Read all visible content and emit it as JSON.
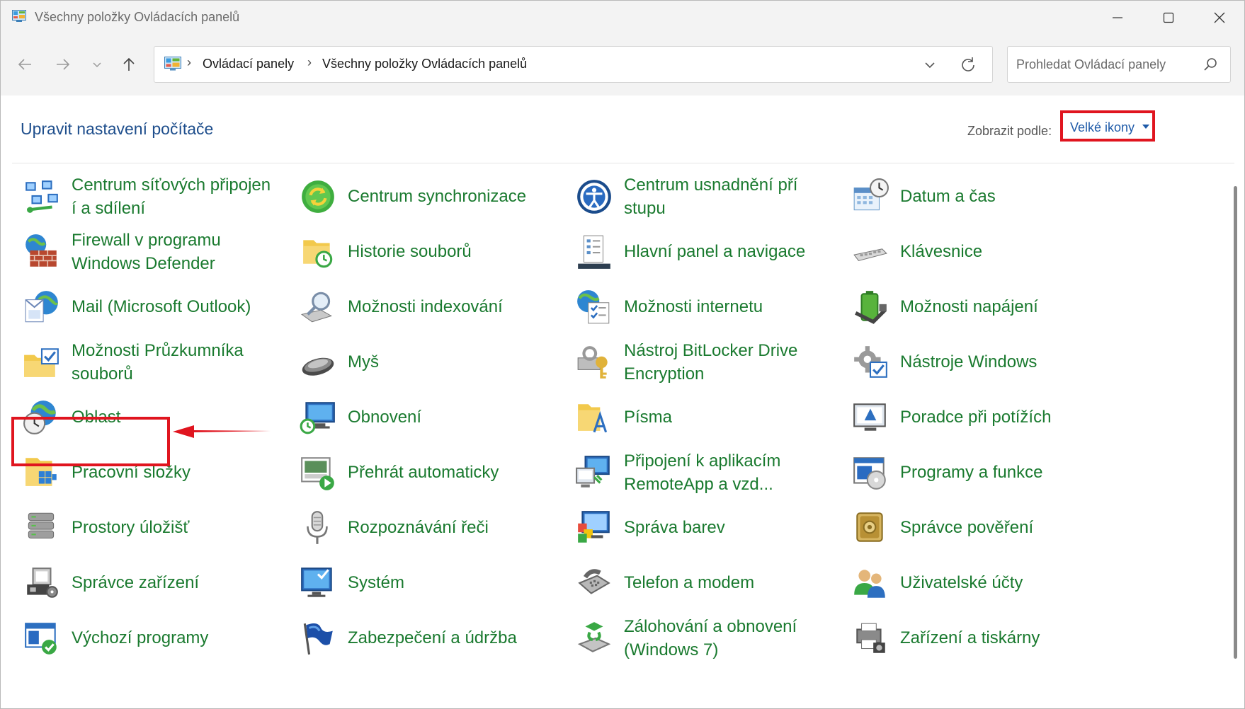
{
  "window": {
    "title": "Všechny položky Ovládacích panelů"
  },
  "nav": {
    "breadcrumb": [
      "Ovládací panely",
      "Všechny položky Ovládacích panelů"
    ],
    "search_placeholder": "Prohledat Ovládací panely"
  },
  "header": {
    "title": "Upravit nastavení počítače",
    "view_by_label": "Zobrazit podle:",
    "view_by_value": "Velké ikony"
  },
  "items": [
    {
      "label": "Centrum síťových připojení a sdílení",
      "line1": "Centrum síťových připojen",
      "line2": "í a sdílení",
      "icon": "network-center-icon"
    },
    {
      "label": "Centrum synchronizace",
      "line1": "Centrum synchronizace",
      "line2": "",
      "icon": "sync-center-icon"
    },
    {
      "label": "Centrum usnadnění přístupu",
      "line1": "Centrum usnadnění pří",
      "line2": "stupu",
      "icon": "ease-of-access-icon"
    },
    {
      "label": "Datum a čas",
      "line1": "Datum a čas",
      "line2": "",
      "icon": "date-time-icon"
    },
    {
      "label": "Firewall v programu Windows Defender",
      "line1": "Firewall v programu",
      "line2": "Windows Defender",
      "icon": "firewall-icon"
    },
    {
      "label": "Historie souborů",
      "line1": "Historie souborů",
      "line2": "",
      "icon": "file-history-icon"
    },
    {
      "label": "Hlavní panel a navigace",
      "line1": "Hlavní panel a navigace",
      "line2": "",
      "icon": "taskbar-icon"
    },
    {
      "label": "Klávesnice",
      "line1": "Klávesnice",
      "line2": "",
      "icon": "keyboard-icon"
    },
    {
      "label": "Mail (Microsoft Outlook)",
      "line1": "Mail (Microsoft Outlook)",
      "line2": "",
      "icon": "mail-icon"
    },
    {
      "label": "Možnosti indexování",
      "line1": "Možnosti indexování",
      "line2": "",
      "icon": "indexing-icon"
    },
    {
      "label": "Možnosti internetu",
      "line1": "Možnosti internetu",
      "line2": "",
      "icon": "internet-options-icon"
    },
    {
      "label": "Možnosti napájení",
      "line1": "Možnosti napájení",
      "line2": "",
      "icon": "power-options-icon"
    },
    {
      "label": "Možnosti Průzkumníka souborů",
      "line1": "Možnosti Průzkumníka",
      "line2": "souborů",
      "icon": "explorer-options-icon"
    },
    {
      "label": "Myš",
      "line1": "Myš",
      "line2": "",
      "icon": "mouse-icon"
    },
    {
      "label": "Nástroj BitLocker Drive Encryption",
      "line1": "Nástroj BitLocker Drive",
      "line2": "Encryption",
      "icon": "bitlocker-icon"
    },
    {
      "label": "Nástroje Windows",
      "line1": "Nástroje Windows",
      "line2": "",
      "icon": "windows-tools-icon"
    },
    {
      "label": "Oblast",
      "line1": "Oblast",
      "line2": "",
      "icon": "region-icon"
    },
    {
      "label": "Obnovení",
      "line1": "Obnovení",
      "line2": "",
      "icon": "recovery-icon"
    },
    {
      "label": "Písma",
      "line1": "Písma",
      "line2": "",
      "icon": "fonts-icon"
    },
    {
      "label": "Poradce při potížích",
      "line1": "Poradce při potížích",
      "line2": "",
      "icon": "troubleshooting-icon"
    },
    {
      "label": "Pracovní složky",
      "line1": "Pracovní složky",
      "line2": "",
      "icon": "work-folders-icon"
    },
    {
      "label": "Přehrát automaticky",
      "line1": "Přehrát automaticky",
      "line2": "",
      "icon": "autoplay-icon"
    },
    {
      "label": "Připojení k aplikacím RemoteApp a vzd...",
      "line1": "Připojení k aplikacím",
      "line2": "RemoteApp a vzd...",
      "icon": "remoteapp-icon"
    },
    {
      "label": "Programy a funkce",
      "line1": "Programy a funkce",
      "line2": "",
      "icon": "programs-features-icon"
    },
    {
      "label": "Prostory úložišť",
      "line1": "Prostory úložišť",
      "line2": "",
      "icon": "storage-spaces-icon"
    },
    {
      "label": "Rozpoznávání řeči",
      "line1": "Rozpoznávání řeči",
      "line2": "",
      "icon": "speech-recognition-icon"
    },
    {
      "label": "Správa barev",
      "line1": "Správa barev",
      "line2": "",
      "icon": "color-management-icon"
    },
    {
      "label": "Správce pověření",
      "line1": "Správce pověření",
      "line2": "",
      "icon": "credential-manager-icon"
    },
    {
      "label": "Správce zařízení",
      "line1": "Správce zařízení",
      "line2": "",
      "icon": "device-manager-icon"
    },
    {
      "label": "Systém",
      "line1": "Systém",
      "line2": "",
      "icon": "system-icon"
    },
    {
      "label": "Telefon a modem",
      "line1": "Telefon a modem",
      "line2": "",
      "icon": "phone-modem-icon"
    },
    {
      "label": "Uživatelské účty",
      "line1": "Uživatelské účty",
      "line2": "",
      "icon": "user-accounts-icon"
    },
    {
      "label": "Výchozí programy",
      "line1": "Výchozí programy",
      "line2": "",
      "icon": "default-programs-icon"
    },
    {
      "label": "Zabezpečení a údržba",
      "line1": "Zabezpečení a údržba",
      "line2": "",
      "icon": "security-maintenance-icon"
    },
    {
      "label": "Zálohování a obnovení (Windows 7)",
      "line1": "Zálohování a obnovení",
      "line2": "(Windows 7)",
      "icon": "backup-restore-icon"
    },
    {
      "label": "Zařízení a tiskárny",
      "line1": "Zařízení a tiskárny",
      "line2": "",
      "icon": "devices-printers-icon"
    }
  ],
  "annotation": {
    "highlighted_item": "Oblast",
    "highlight_color": "#e0151f"
  },
  "colors": {
    "item_text": "#1a7a2f",
    "title_text": "#1e4e8c",
    "link_text": "#1e5aa8"
  }
}
